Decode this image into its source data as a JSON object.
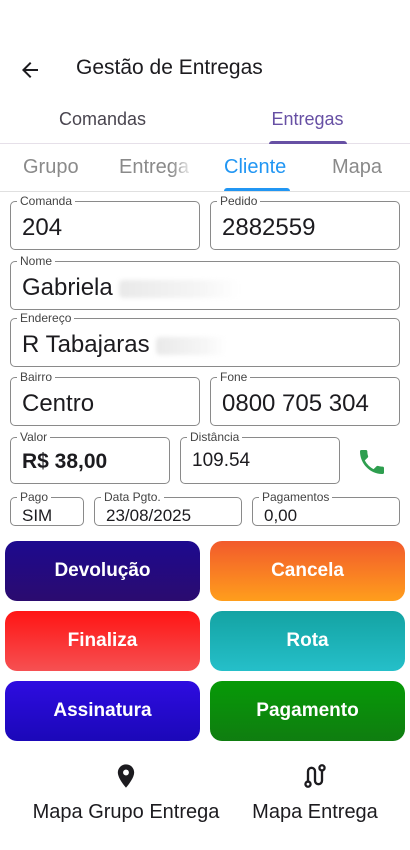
{
  "header": {
    "title": "Gestão de Entregas"
  },
  "primary_tabs": [
    {
      "label": "Comandas",
      "selected": false
    },
    {
      "label": "Entregas",
      "selected": true
    }
  ],
  "secondary_tabs": [
    {
      "label": "Grupo",
      "selected": false
    },
    {
      "label": "Entrega",
      "selected": false
    },
    {
      "label": "Cliente",
      "selected": true
    },
    {
      "label": "Mapa",
      "selected": false
    }
  ],
  "fields": {
    "comanda": {
      "label": "Comanda",
      "value": "204"
    },
    "pedido": {
      "label": "Pedido",
      "value": "2882559"
    },
    "nome": {
      "label": "Nome",
      "value": "Gabriela"
    },
    "endereco": {
      "label": "Endereço",
      "value": "R Tabajaras"
    },
    "bairro": {
      "label": "Bairro",
      "value": "Centro"
    },
    "fone": {
      "label": "Fone",
      "value": "0800 705 304"
    },
    "valor": {
      "label": "Valor",
      "value": "R$ 38,00"
    },
    "distancia": {
      "label": "Distância",
      "value": "109.54"
    },
    "pago": {
      "label": "Pago",
      "value": "SIM"
    },
    "data_pgto": {
      "label": "Data Pgto.",
      "value": "23/08/2025"
    },
    "pagamentos": {
      "label": "Pagamentos",
      "value": "0,00"
    }
  },
  "buttons": {
    "devolucao": "Devolução",
    "cancela": "Cancela",
    "finaliza": "Finaliza",
    "rota": "Rota",
    "assinatura": "Assinatura",
    "pagamento": "Pagamento"
  },
  "bottom_nav": [
    {
      "label": "Mapa Grupo Entrega",
      "icon": "map-pin-icon"
    },
    {
      "label": "Mapa Entrega",
      "icon": "route-icon"
    }
  ],
  "colors": {
    "primary_tab": "#6750a4",
    "secondary_tab": "#2196f3",
    "phone": "#2e9e4f"
  }
}
